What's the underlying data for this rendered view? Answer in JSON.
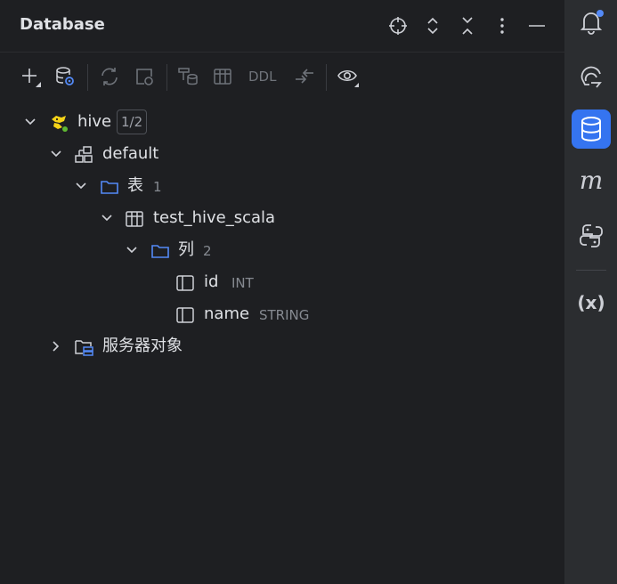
{
  "panel": {
    "title": "Database"
  },
  "toolbar": {
    "ddl_label": "DDL"
  },
  "tree": {
    "hive": {
      "label": "hive",
      "badge": "1/2"
    },
    "default": {
      "label": "default"
    },
    "tables_folder": {
      "label": "表",
      "count": "1"
    },
    "table": {
      "label": "test_hive_scala"
    },
    "columns_folder": {
      "label": "列",
      "count": "2"
    },
    "columns": [
      {
        "name": "id",
        "type": "INT"
      },
      {
        "name": "name",
        "type": "STRING"
      }
    ],
    "server_objects": {
      "label": "服务器对象"
    }
  },
  "rail": {
    "italic_m": "m",
    "variables_label": "(x)"
  },
  "colors": {
    "accent": "#3574f0",
    "folder": "#548af7",
    "notify_dot": "#548af7"
  }
}
